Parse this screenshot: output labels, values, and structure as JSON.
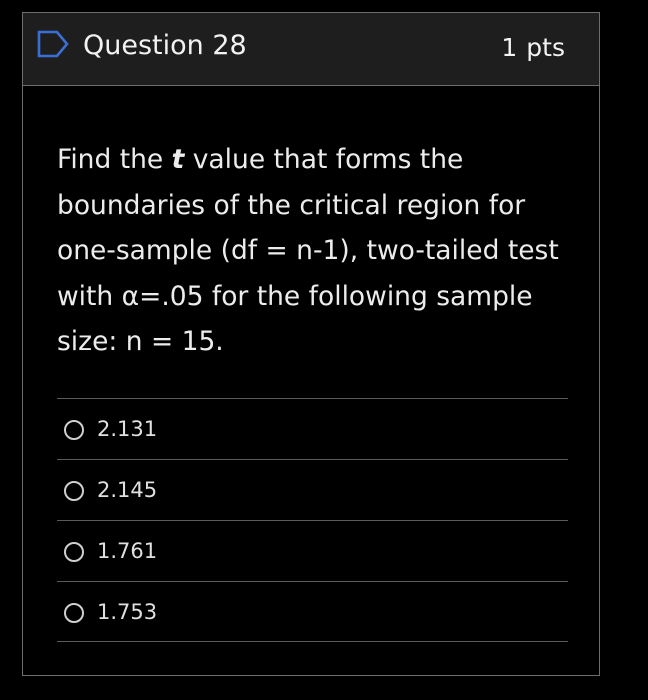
{
  "question": {
    "title": "Question 28",
    "points_value": "1",
    "points_unit": "pts",
    "flag_icon": "bookmark-flag-icon",
    "text_parts": {
      "before": "Find the ",
      "variable": "t",
      "after": " value that forms the boundaries of the critical region for one-sample (df = n-1), two-tailed test with α=.05 for the following sample size: n = 15."
    }
  },
  "answers": [
    {
      "label": "2.131",
      "selected": false
    },
    {
      "label": "2.145",
      "selected": false
    },
    {
      "label": "1.761",
      "selected": false
    },
    {
      "label": "1.753",
      "selected": false
    }
  ],
  "colors": {
    "background": "#000000",
    "header_bg": "#1e1e1e",
    "border": "#6d6d6d",
    "flag_stroke": "#3b6fd8",
    "text": "#ececec"
  }
}
